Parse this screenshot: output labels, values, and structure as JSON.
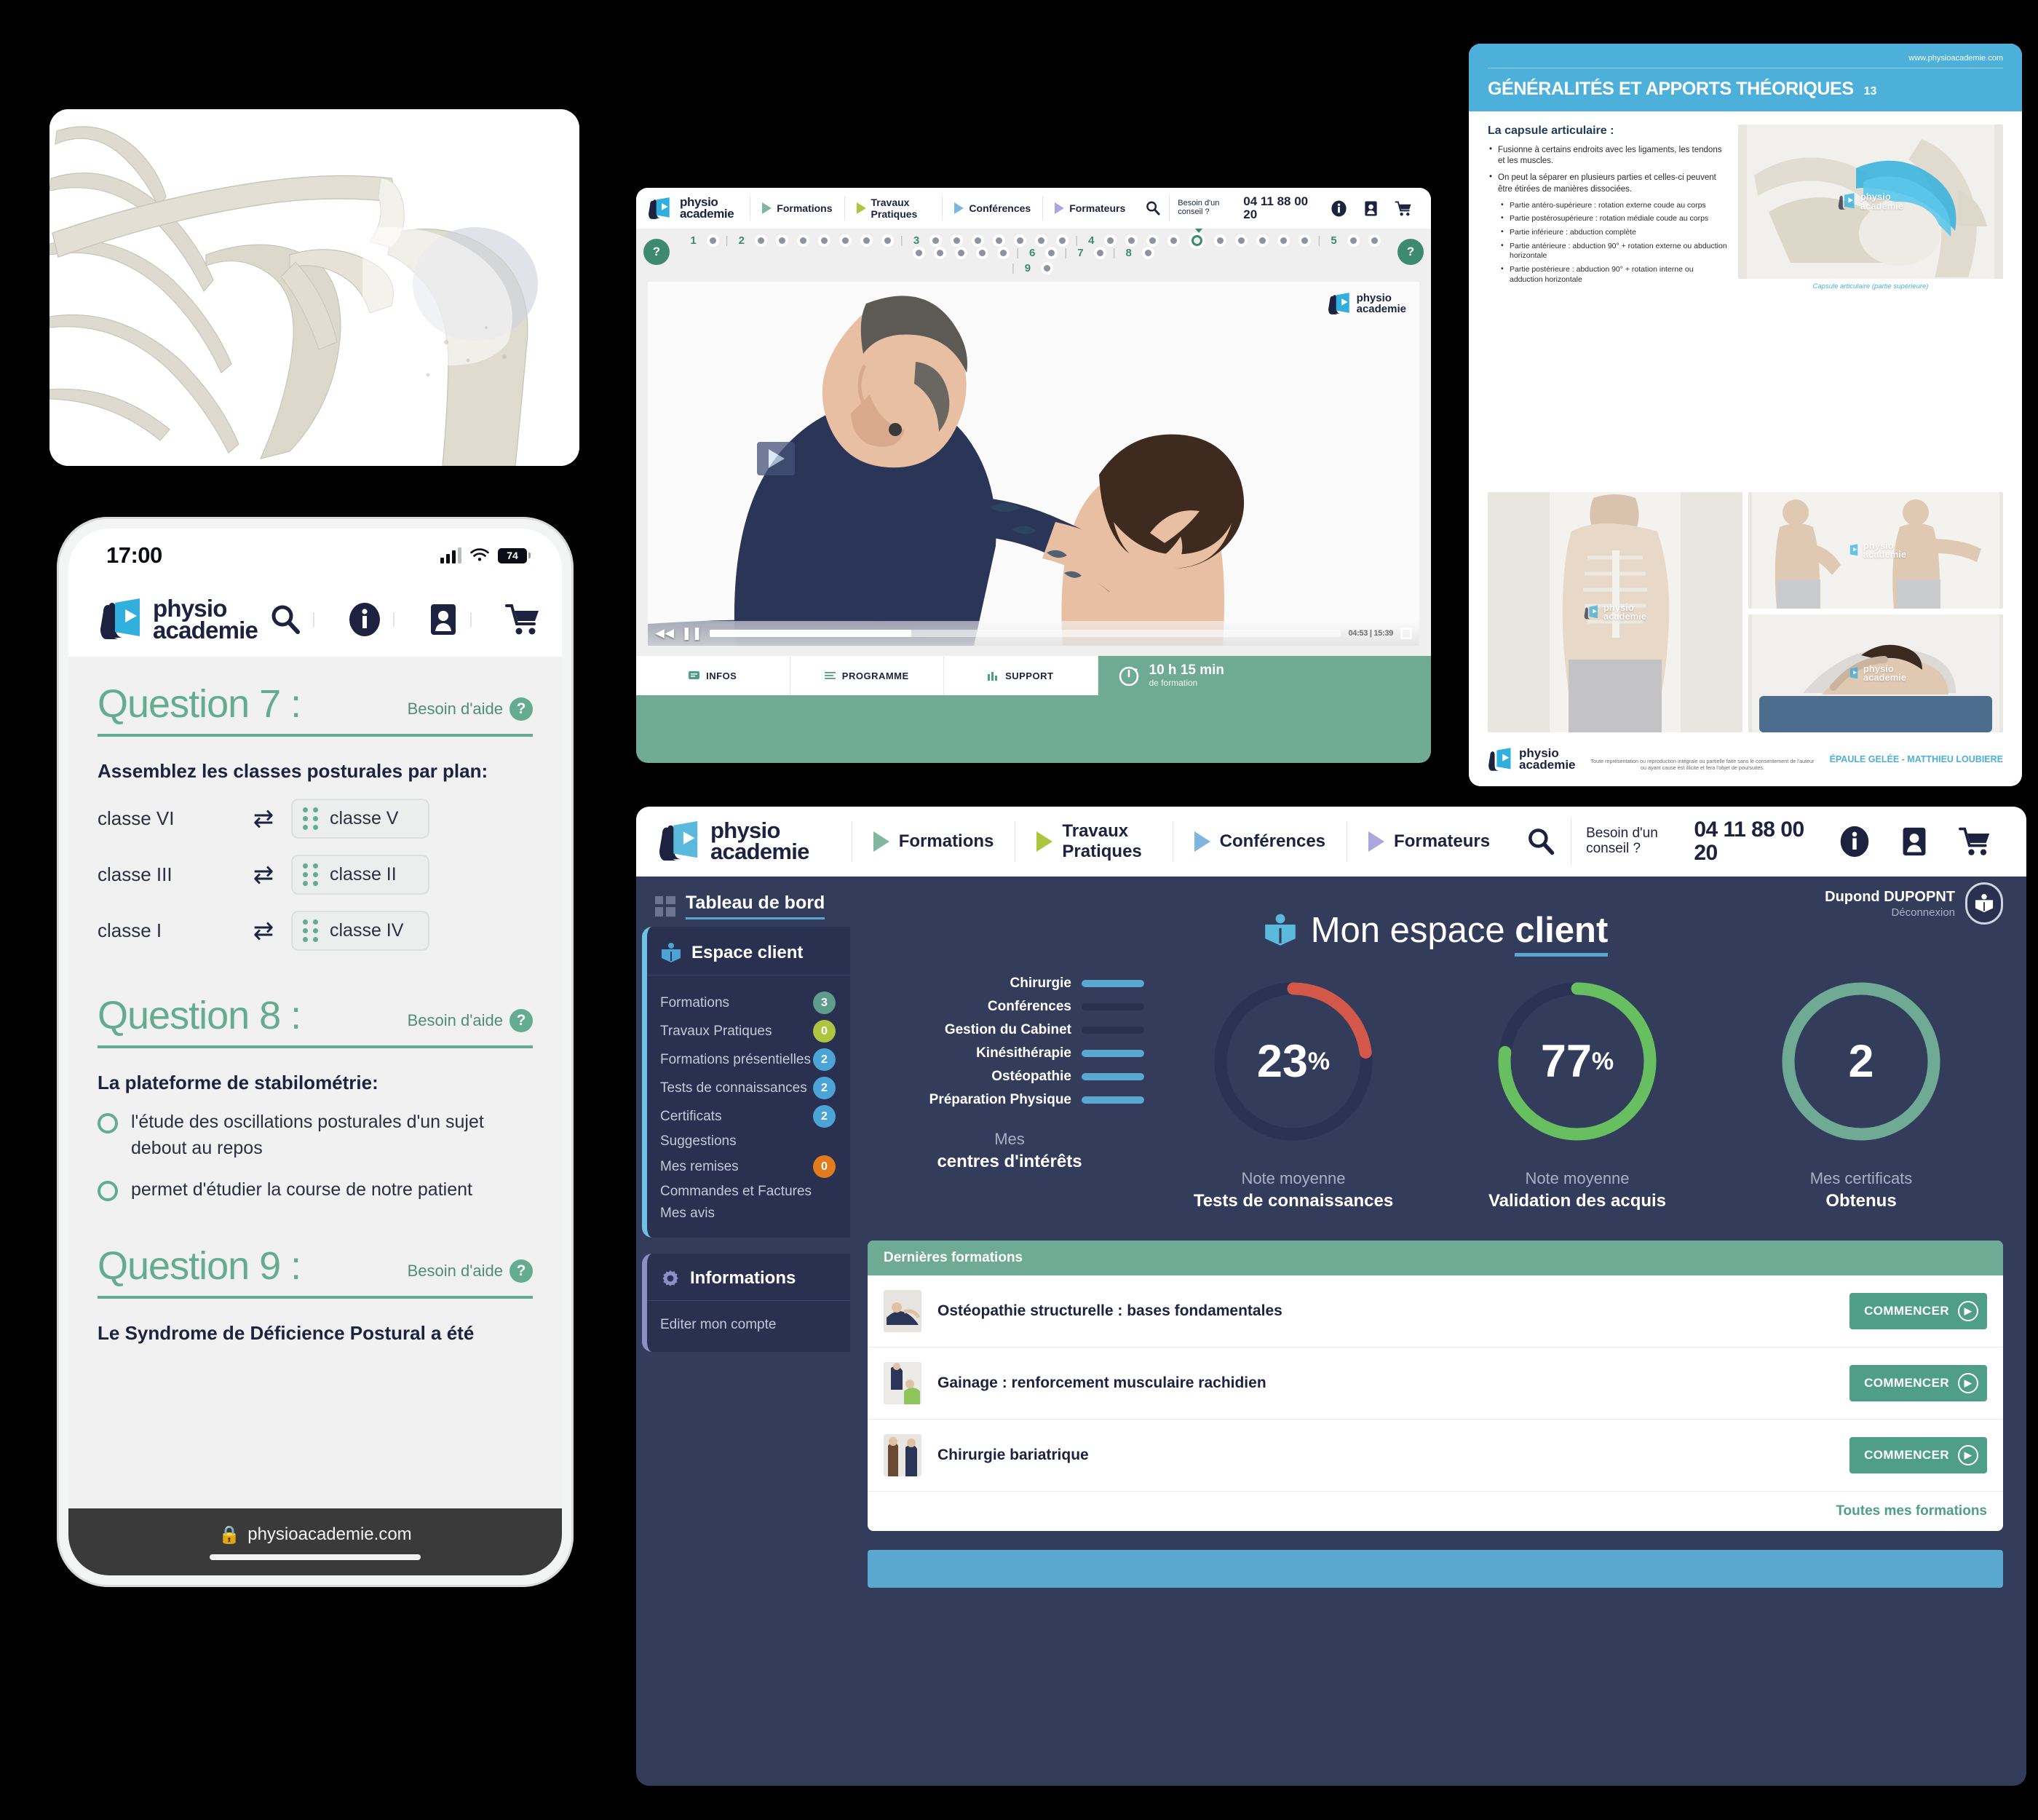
{
  "brand": {
    "name_line1": "physio",
    "name_line2": "academie",
    "accent_blue": "#4db0db",
    "accent_green": "#6faa95",
    "navy": "#1d2240"
  },
  "anatomy_card": {
    "alt": "shoulder-joint-3d-render"
  },
  "phone": {
    "status": {
      "time": "17:00",
      "battery": "74"
    },
    "url_bar": {
      "lock": "🔒",
      "url": "physioacademie.com"
    },
    "header_icons": [
      "search-icon",
      "info-icon",
      "account-icon",
      "cart-icon"
    ],
    "questions": [
      {
        "title": "Question 7 :",
        "help": "Besoin d'aide",
        "prompt": "Assemblez les classes posturales par plan:",
        "type": "match",
        "pairs": [
          {
            "left": "classe VI",
            "right": "classe V"
          },
          {
            "left": "classe III",
            "right": "classe II"
          },
          {
            "left": "classe I",
            "right": "classe IV"
          }
        ]
      },
      {
        "title": "Question 8 :",
        "help": "Besoin d'aide",
        "prompt": "La plateforme de stabilométrie:",
        "type": "radio",
        "options": [
          "l'étude des oscillations posturales d'un sujet debout au repos",
          "permet d'étudier la course de notre patient"
        ]
      },
      {
        "title": "Question 9 :",
        "help": "Besoin d'aide",
        "prompt": "Le Syndrome de Déficience Postural a été",
        "type": "text"
      }
    ]
  },
  "player": {
    "nav": [
      {
        "label": "Formations",
        "color": "#7fb89e"
      },
      {
        "label": "Travaux Pratiques",
        "color": "#aec63f"
      },
      {
        "label": "Conférences",
        "color": "#7fb6dd"
      },
      {
        "label": "Formateurs",
        "color": "#a9a7dd"
      }
    ],
    "advice": {
      "line1": "Besoin d'un conseil ?",
      "line2": "04 11 88 00 20"
    },
    "chapters": [
      {
        "num": "1",
        "dots": 1
      },
      {
        "num": "2",
        "dots": 7
      },
      {
        "num": "3",
        "dots": 7
      },
      {
        "num": "4",
        "dots": 10,
        "current_index": 4
      },
      {
        "num": "5",
        "dots": 7
      },
      {
        "num": "6",
        "dots": 1
      },
      {
        "num": "7",
        "dots": 1
      },
      {
        "num": "8",
        "dots": 1
      },
      {
        "num": "9",
        "dots": 1
      }
    ],
    "quiz_button_label": "?",
    "video": {
      "current_time": "04:53",
      "duration": "15:39",
      "time_display": "04:53 | 15:39",
      "progress_percent": 32
    },
    "tabs": [
      {
        "label": "INFOS",
        "icon": "infos-icon"
      },
      {
        "label": "PROGRAMME",
        "icon": "programme-icon"
      },
      {
        "label": "SUPPORT",
        "icon": "support-icon"
      }
    ],
    "duration_badge": {
      "value": "10 h 15 min",
      "caption": "de formation"
    }
  },
  "pdf": {
    "url": "www.physioacademie.com",
    "title": "GÉNÉRALITÉS ET APPORTS THÉORIQUES",
    "page": "13",
    "heading": "La capsule articulaire :",
    "bullets": [
      "Fusionne à certains endroits avec les ligaments, les tendons et les muscles.",
      "On peut la séparer en plusieurs parties et celles-ci peuvent être étirées de manières dissociées."
    ],
    "sub_bullets": [
      "Partie antéro-supérieure : rotation externe coude au corps",
      "Partie postérosupérieure : rotation médiale coude au corps",
      "Partie inférieure : abduction complète",
      "Partie antérieure : abduction 90° + rotation externe ou abduction horizontale",
      "Partie postérieure : abduction 90° + rotation interne ou adduction horizontale"
    ],
    "caption": "Capsule articulaire (partie supérieure)",
    "footer_legal": "Toute représentation ou reproduction intégrale ou partielle faite sans le consentement de l'auteur ou ayant cause est illicite et fera l'objet de poursuites.",
    "footer_title": "ÉPAULE GELÉE - MATTHIEU LOUBIERE"
  },
  "dashboard": {
    "nav": [
      {
        "label": "Formations",
        "color": "#7fb89e"
      },
      {
        "label": "Travaux Pratiques",
        "color": "#aec63f"
      },
      {
        "label": "Conférences",
        "color": "#7fb6dd"
      },
      {
        "label": "Formateurs",
        "color": "#a9a7dd"
      }
    ],
    "advice": {
      "line1": "Besoin d'un conseil ?",
      "line2": "04 11 88 00 20"
    },
    "sidebar": {
      "top_label": "Tableau de bord",
      "section1_title": "Espace client",
      "items": [
        {
          "label": "Formations",
          "badge": "3",
          "badge_color": "#5e9c8c"
        },
        {
          "label": "Travaux Pratiques",
          "badge": "0",
          "badge_color": "#aec63f"
        },
        {
          "label": "Formations présentielles",
          "badge": "2",
          "badge_color": "#4ba3d6"
        },
        {
          "label": "Tests de connaissances",
          "badge": "2",
          "badge_color": "#4ba3d6"
        },
        {
          "label": "Certificats",
          "badge": "2",
          "badge_color": "#4ba3d6"
        },
        {
          "label": "Suggestions",
          "badge": ""
        },
        {
          "label": "Mes remises",
          "badge": "0",
          "badge_color": "#e07b1e"
        },
        {
          "label": "Commandes et Factures",
          "badge": ""
        },
        {
          "label": "Mes avis",
          "badge": ""
        }
      ],
      "section2_title": "Informations",
      "section2_items": [
        {
          "label": "Editer mon compte"
        }
      ]
    },
    "user": {
      "name": "Dupond DUPOPNT",
      "logout": "Déconnexion"
    },
    "page_title_light": "Mon espace ",
    "page_title_bold": "client",
    "last_formations": {
      "header": "Dernières formations",
      "rows": [
        {
          "name": "Ostéopathie structurelle : bases fondamentales",
          "button": "COMMENCER"
        },
        {
          "name": "Gainage : renforcement musculaire rachidien",
          "button": "COMMENCER"
        },
        {
          "name": "Chirurgie bariatrique",
          "button": "COMMENCER"
        }
      ],
      "footer_link": "Toutes mes formations"
    }
  },
  "chart_data": [
    {
      "type": "bar",
      "title": "Mes centres d'intérêts",
      "categories": [
        "Chirurgie",
        "Conférences",
        "Gestion du Cabinet",
        "Kinésithérapie",
        "Ostéopathie",
        "Préparation Physique"
      ],
      "values": [
        1,
        0,
        0,
        1,
        1,
        1
      ],
      "colors": [
        "#5aa7d0",
        "#2a3150",
        "#2a3150",
        "#5aa7d0",
        "#5aa7d0",
        "#5aa7d0"
      ],
      "note": "Active interests are light blue; inactive are dark navy",
      "caption_line1": "Mes",
      "caption_line2": "centres d'intérêts"
    },
    {
      "type": "pie",
      "subtype": "donut-gauge",
      "title": "Note moyenne Tests de connaissances",
      "value": 23,
      "unit": "%",
      "display": "23%",
      "track_color": "#2b3355",
      "arc_color": "#d4584a",
      "caption_line1": "Note moyenne",
      "caption_line2": "Tests de connaissances"
    },
    {
      "type": "pie",
      "subtype": "donut-gauge",
      "title": "Note moyenne Validation des acquis",
      "value": 77,
      "unit": "%",
      "display": "77%",
      "track_color": "#2b3355",
      "arc_color": "#68bf60",
      "caption_line1": "Note moyenne",
      "caption_line2": "Validation des acquis"
    },
    {
      "type": "pie",
      "subtype": "donut-gauge",
      "title": "Mes certificats Obtenus",
      "value": 100,
      "unit": "",
      "display": "2",
      "track_color": "#6faa95",
      "arc_color": "#6faa95",
      "caption_line1": "Mes certificats",
      "caption_line2": "Obtenus"
    }
  ]
}
